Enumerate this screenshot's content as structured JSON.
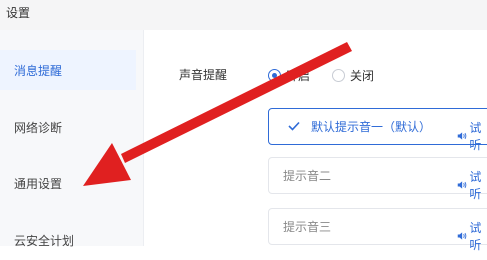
{
  "window": {
    "title": "设置"
  },
  "sidebar": {
    "items": [
      {
        "label": "消息提醒",
        "active": true
      },
      {
        "label": "网络诊断",
        "active": false
      },
      {
        "label": "通用设置",
        "active": false
      },
      {
        "label": "云安全计划",
        "active": false
      }
    ]
  },
  "sound": {
    "label": "声音提醒",
    "options": [
      {
        "label": "开启",
        "checked": true
      },
      {
        "label": "关闭",
        "checked": false
      }
    ],
    "items": [
      {
        "name": "默认提示音一（默认）",
        "selected": true,
        "trial": "试听"
      },
      {
        "name": "提示音二",
        "selected": false,
        "trial": "试听"
      },
      {
        "name": "提示音三",
        "selected": false,
        "trial": "试听"
      }
    ]
  },
  "colors": {
    "accent": "#2f6bd7",
    "arrow": "#e02020"
  },
  "icons": [
    "check-icon",
    "speaker-icon"
  ]
}
